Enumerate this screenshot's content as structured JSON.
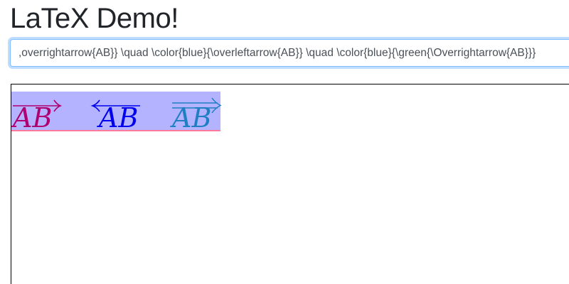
{
  "page": {
    "title": "LaTeX Demo!"
  },
  "input": {
    "value": ",overrightarrow{AB}} \\quad \\color{blue}{\\overleftarrow{AB}} \\quad \\color{blue}{\\green{\\Overrightarrow{AB}}}"
  },
  "render": {
    "highlight_color": "#b3b3ff",
    "baseline_color": "#ff7a9a",
    "terms": [
      {
        "text": "AB",
        "arrow": "overrightarrow",
        "color": "#b00070"
      },
      {
        "text": "AB",
        "arrow": "overleftarrow",
        "color": "#0000ee"
      },
      {
        "text": "AB",
        "arrow": "Overrightarrow",
        "color": "#1f7fc4"
      }
    ]
  }
}
